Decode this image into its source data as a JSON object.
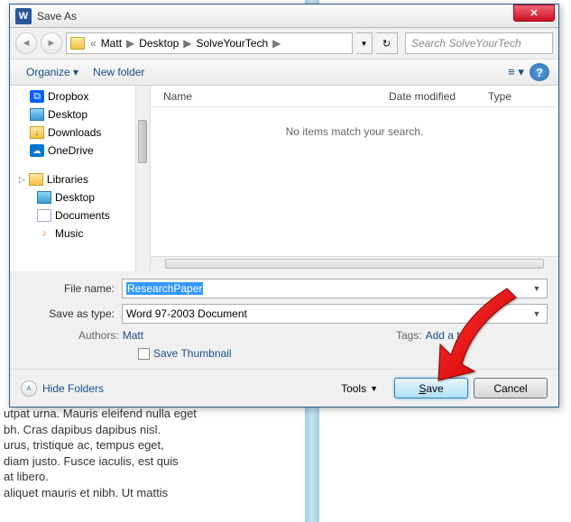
{
  "bg_text": "utpat urna. Mauris eleifend nulla eget\nbh. Cras dapibus dapibus nisl.\nurus, tristique ac, tempus eget,\ndiam justo. Fusce iaculis, est quis\nat libero.\naliquet mauris et nibh. Ut mattis",
  "title": "Save As",
  "breadcrumbs": [
    "Matt",
    "Desktop",
    "SolveYourTech"
  ],
  "search_placeholder": "Search SolveYourTech",
  "toolbar": {
    "organize": "Organize",
    "newfolder": "New folder"
  },
  "sidebar": {
    "items": [
      "Dropbox",
      "Desktop",
      "Downloads",
      "OneDrive"
    ],
    "libraries_label": "Libraries",
    "lib_items": [
      "Desktop",
      "Documents",
      "Music"
    ]
  },
  "columns": {
    "name": "Name",
    "date": "Date modified",
    "type": "Type"
  },
  "empty_msg": "No items match your search.",
  "filename_label": "File name:",
  "filename_value": "ResearchPaper",
  "savetype_label": "Save as type:",
  "savetype_value": "Word 97-2003 Document",
  "authors_label": "Authors:",
  "authors_value": "Matt",
  "tags_label": "Tags:",
  "tags_value": "Add a tag",
  "save_thumb": "Save Thumbnail",
  "hide_folders": "Hide Folders",
  "tools": "Tools",
  "save": "Save",
  "cancel": "Cancel"
}
